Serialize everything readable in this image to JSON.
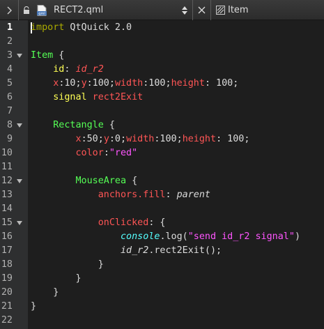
{
  "toolbar": {
    "filename": "RECT2.qml",
    "file_icon_label": "qml",
    "breadcrumb": "Item"
  },
  "editor": {
    "line_numbers": [
      "1",
      "2",
      "3",
      "4",
      "5",
      "6",
      "7",
      "8",
      "9",
      "10",
      "11",
      "12",
      "13",
      "14",
      "15",
      "16",
      "17",
      "18",
      "19",
      "20",
      "21",
      "22"
    ],
    "current_line": "1",
    "foldable_lines": [
      "3",
      "8",
      "12",
      "15"
    ],
    "lines": [
      [
        [
          "import",
          "t-kw"
        ],
        [
          " QtQuick 2.0",
          "t-num"
        ]
      ],
      [],
      [
        [
          "Item",
          "t-type"
        ],
        [
          " {",
          "t-num"
        ]
      ],
      [
        [
          "    ",
          ""
        ],
        [
          "id",
          "t-id"
        ],
        [
          ": ",
          "t-num"
        ],
        [
          "id_r2",
          "t-it"
        ]
      ],
      [
        [
          "    ",
          ""
        ],
        [
          "x",
          "t-prop"
        ],
        [
          ":10;",
          "t-num"
        ],
        [
          "y",
          "t-prop"
        ],
        [
          ":100;",
          "t-num"
        ],
        [
          "width",
          "t-prop"
        ],
        [
          ":100;",
          "t-num"
        ],
        [
          "height",
          "t-prop"
        ],
        [
          ": 100;",
          "t-num"
        ]
      ],
      [
        [
          "    ",
          ""
        ],
        [
          "signal",
          "t-id"
        ],
        [
          " rect2Exit",
          "t-prop"
        ]
      ],
      [],
      [
        [
          "    ",
          ""
        ],
        [
          "Rectangle",
          "t-type"
        ],
        [
          " {",
          "t-num"
        ]
      ],
      [
        [
          "        ",
          ""
        ],
        [
          "x",
          "t-prop"
        ],
        [
          ":50;",
          "t-num"
        ],
        [
          "y",
          "t-prop"
        ],
        [
          ":0;",
          "t-num"
        ],
        [
          "width",
          "t-prop"
        ],
        [
          ":100;",
          "t-num"
        ],
        [
          "height",
          "t-prop"
        ],
        [
          ": 100;",
          "t-num"
        ]
      ],
      [
        [
          "        ",
          ""
        ],
        [
          "color",
          "t-prop"
        ],
        [
          ":",
          "t-num"
        ],
        [
          "\"red\"",
          "t-str"
        ]
      ],
      [],
      [
        [
          "        ",
          ""
        ],
        [
          "MouseArea",
          "t-type"
        ],
        [
          " {",
          "t-num"
        ]
      ],
      [
        [
          "            ",
          ""
        ],
        [
          "anchors.fill",
          "t-prop"
        ],
        [
          ": ",
          "t-num"
        ],
        [
          "parent",
          "t-it2"
        ]
      ],
      [],
      [
        [
          "            ",
          ""
        ],
        [
          "onClicked",
          "t-prop"
        ],
        [
          ": {",
          "t-num"
        ]
      ],
      [
        [
          "                ",
          ""
        ],
        [
          "console",
          "t-var"
        ],
        [
          ".log(",
          "t-num"
        ],
        [
          "\"send id_r2 signal\"",
          "t-str"
        ],
        [
          ")",
          "t-num"
        ]
      ],
      [
        [
          "                ",
          ""
        ],
        [
          "id_r2",
          "t-it2"
        ],
        [
          ".rect2Exit();",
          "t-num"
        ]
      ],
      [
        [
          "            ",
          ""
        ],
        [
          "}",
          "t-num"
        ]
      ],
      [
        [
          "        ",
          ""
        ],
        [
          "}",
          "t-num"
        ]
      ],
      [
        [
          "    ",
          ""
        ],
        [
          "}",
          "t-num"
        ]
      ],
      [
        [
          "}",
          "t-num"
        ]
      ],
      []
    ]
  }
}
